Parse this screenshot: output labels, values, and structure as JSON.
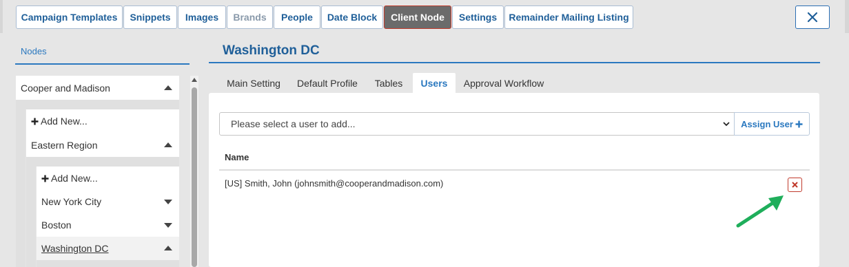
{
  "nav": {
    "items": [
      {
        "label": "Campaign Templates",
        "state": "normal"
      },
      {
        "label": "Snippets",
        "state": "normal"
      },
      {
        "label": "Images",
        "state": "normal"
      },
      {
        "label": "Brands",
        "state": "disabled"
      },
      {
        "label": "People",
        "state": "normal"
      },
      {
        "label": "Date Block",
        "state": "normal"
      },
      {
        "label": "Client Node",
        "state": "active"
      },
      {
        "label": "Settings",
        "state": "normal"
      },
      {
        "label": "Remainder Mailing Listing",
        "state": "normal"
      }
    ],
    "close_icon": "close-icon"
  },
  "sidebar": {
    "title": "Nodes",
    "tree": {
      "root": {
        "label": "Cooper and Madison",
        "expanded": true
      },
      "root_add": "Add New...",
      "region": {
        "label": "Eastern Region",
        "expanded": true
      },
      "region_add": "Add New...",
      "cities": [
        {
          "label": "New York City",
          "expanded": false
        },
        {
          "label": "Boston",
          "expanded": false
        },
        {
          "label": "Washington DC",
          "expanded": true,
          "selected": true
        }
      ]
    }
  },
  "main": {
    "title": "Washington DC",
    "tabs": [
      {
        "label": "Main Setting",
        "active": false
      },
      {
        "label": "Default Profile",
        "active": false
      },
      {
        "label": "Tables",
        "active": false
      },
      {
        "label": "Users",
        "active": true
      },
      {
        "label": "Approval Workflow",
        "active": false
      }
    ],
    "users": {
      "select_placeholder": "Please select a user to add...",
      "assign_label": "Assign User",
      "column_name": "Name",
      "rows": [
        {
          "name": "[US] Smith, John (johnsmith@cooperandmadison.com)"
        }
      ]
    }
  },
  "colors": {
    "accent": "#2a78bf",
    "nav_text": "#1f5f99",
    "active_tab_bg": "#6b6b6b",
    "danger": "#c0392b",
    "annotation_arrow": "#1fae5b"
  }
}
